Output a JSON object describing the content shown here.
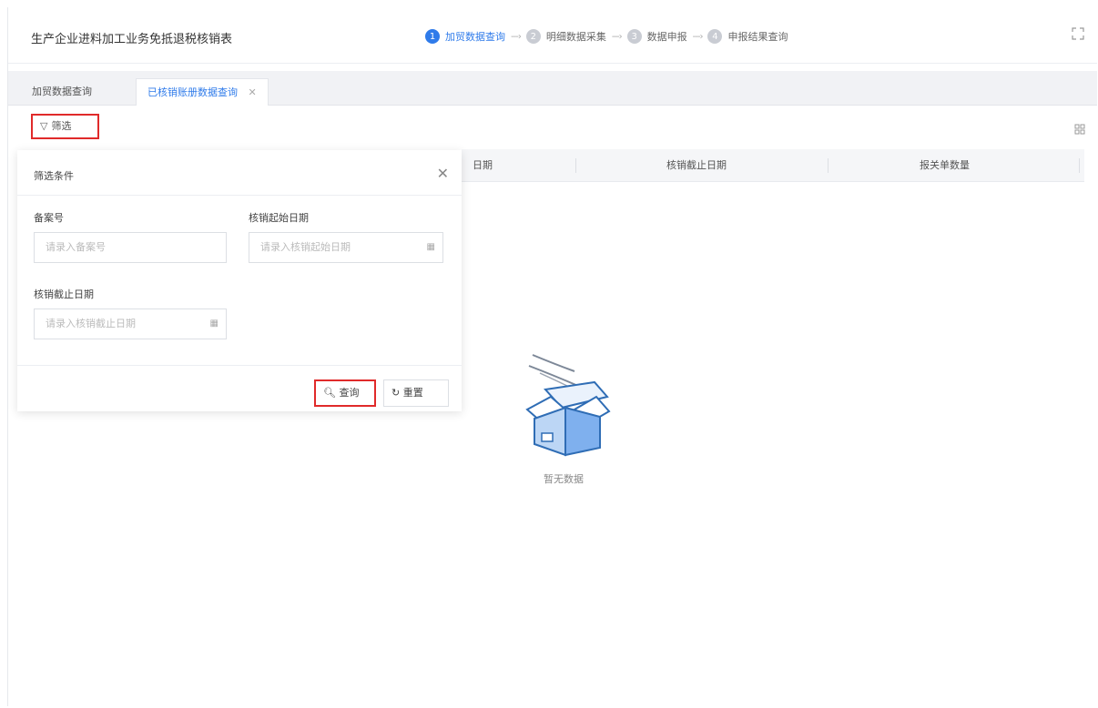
{
  "app": {
    "title": "生产企业进料加工业务免抵退税核销表",
    "fullscreen_icon": "fullscreen-icon"
  },
  "steps": [
    {
      "num": "1",
      "label": "加贸数据查询",
      "active": true
    },
    {
      "num": "2",
      "label": "明细数据采集",
      "active": false
    },
    {
      "num": "3",
      "label": "数据申报",
      "active": false
    },
    {
      "num": "4",
      "label": "申报结果查询",
      "active": false
    }
  ],
  "tabs": {
    "tab1_label": "加贸数据查询",
    "tab2_label": "已核销账册数据查询",
    "close_icon": "close-icon"
  },
  "toolbar": {
    "filter_label": "筛选",
    "filter_icon": "funnel-icon",
    "settings_icon": "grid-settings-icon"
  },
  "table": {
    "columns": [
      "日期",
      "核销截止日期",
      "报关单数量"
    ]
  },
  "empty_state": {
    "text": "暂无数据",
    "icon": "empty-box-icon"
  },
  "filter_panel": {
    "title": "筛选条件",
    "fields": {
      "record_no": {
        "label": "备案号",
        "placeholder": "请录入备案号"
      },
      "start_date": {
        "label": "核销起始日期",
        "placeholder": "请录入核销起始日期"
      },
      "end_date": {
        "label": "核销截止日期",
        "placeholder": "请录入核销截止日期"
      }
    },
    "search_label": "查询",
    "reset_label": "重置"
  },
  "colors": {
    "accent": "#2f7bea",
    "highlight_border": "#e02a2a"
  }
}
